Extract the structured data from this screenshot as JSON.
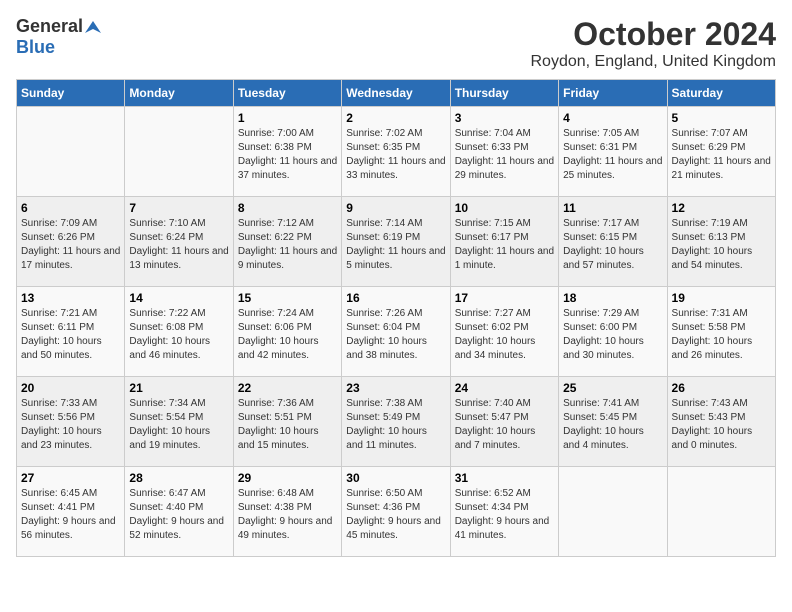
{
  "logo": {
    "general": "General",
    "blue": "Blue"
  },
  "header": {
    "month": "October 2024",
    "location": "Roydon, England, United Kingdom"
  },
  "weekdays": [
    "Sunday",
    "Monday",
    "Tuesday",
    "Wednesday",
    "Thursday",
    "Friday",
    "Saturday"
  ],
  "weeks": [
    [
      {
        "day": "",
        "sunrise": "",
        "sunset": "",
        "daylight": ""
      },
      {
        "day": "",
        "sunrise": "",
        "sunset": "",
        "daylight": ""
      },
      {
        "day": "1",
        "sunrise": "Sunrise: 7:00 AM",
        "sunset": "Sunset: 6:38 PM",
        "daylight": "Daylight: 11 hours and 37 minutes."
      },
      {
        "day": "2",
        "sunrise": "Sunrise: 7:02 AM",
        "sunset": "Sunset: 6:35 PM",
        "daylight": "Daylight: 11 hours and 33 minutes."
      },
      {
        "day": "3",
        "sunrise": "Sunrise: 7:04 AM",
        "sunset": "Sunset: 6:33 PM",
        "daylight": "Daylight: 11 hours and 29 minutes."
      },
      {
        "day": "4",
        "sunrise": "Sunrise: 7:05 AM",
        "sunset": "Sunset: 6:31 PM",
        "daylight": "Daylight: 11 hours and 25 minutes."
      },
      {
        "day": "5",
        "sunrise": "Sunrise: 7:07 AM",
        "sunset": "Sunset: 6:29 PM",
        "daylight": "Daylight: 11 hours and 21 minutes."
      }
    ],
    [
      {
        "day": "6",
        "sunrise": "Sunrise: 7:09 AM",
        "sunset": "Sunset: 6:26 PM",
        "daylight": "Daylight: 11 hours and 17 minutes."
      },
      {
        "day": "7",
        "sunrise": "Sunrise: 7:10 AM",
        "sunset": "Sunset: 6:24 PM",
        "daylight": "Daylight: 11 hours and 13 minutes."
      },
      {
        "day": "8",
        "sunrise": "Sunrise: 7:12 AM",
        "sunset": "Sunset: 6:22 PM",
        "daylight": "Daylight: 11 hours and 9 minutes."
      },
      {
        "day": "9",
        "sunrise": "Sunrise: 7:14 AM",
        "sunset": "Sunset: 6:19 PM",
        "daylight": "Daylight: 11 hours and 5 minutes."
      },
      {
        "day": "10",
        "sunrise": "Sunrise: 7:15 AM",
        "sunset": "Sunset: 6:17 PM",
        "daylight": "Daylight: 11 hours and 1 minute."
      },
      {
        "day": "11",
        "sunrise": "Sunrise: 7:17 AM",
        "sunset": "Sunset: 6:15 PM",
        "daylight": "Daylight: 10 hours and 57 minutes."
      },
      {
        "day": "12",
        "sunrise": "Sunrise: 7:19 AM",
        "sunset": "Sunset: 6:13 PM",
        "daylight": "Daylight: 10 hours and 54 minutes."
      }
    ],
    [
      {
        "day": "13",
        "sunrise": "Sunrise: 7:21 AM",
        "sunset": "Sunset: 6:11 PM",
        "daylight": "Daylight: 10 hours and 50 minutes."
      },
      {
        "day": "14",
        "sunrise": "Sunrise: 7:22 AM",
        "sunset": "Sunset: 6:08 PM",
        "daylight": "Daylight: 10 hours and 46 minutes."
      },
      {
        "day": "15",
        "sunrise": "Sunrise: 7:24 AM",
        "sunset": "Sunset: 6:06 PM",
        "daylight": "Daylight: 10 hours and 42 minutes."
      },
      {
        "day": "16",
        "sunrise": "Sunrise: 7:26 AM",
        "sunset": "Sunset: 6:04 PM",
        "daylight": "Daylight: 10 hours and 38 minutes."
      },
      {
        "day": "17",
        "sunrise": "Sunrise: 7:27 AM",
        "sunset": "Sunset: 6:02 PM",
        "daylight": "Daylight: 10 hours and 34 minutes."
      },
      {
        "day": "18",
        "sunrise": "Sunrise: 7:29 AM",
        "sunset": "Sunset: 6:00 PM",
        "daylight": "Daylight: 10 hours and 30 minutes."
      },
      {
        "day": "19",
        "sunrise": "Sunrise: 7:31 AM",
        "sunset": "Sunset: 5:58 PM",
        "daylight": "Daylight: 10 hours and 26 minutes."
      }
    ],
    [
      {
        "day": "20",
        "sunrise": "Sunrise: 7:33 AM",
        "sunset": "Sunset: 5:56 PM",
        "daylight": "Daylight: 10 hours and 23 minutes."
      },
      {
        "day": "21",
        "sunrise": "Sunrise: 7:34 AM",
        "sunset": "Sunset: 5:54 PM",
        "daylight": "Daylight: 10 hours and 19 minutes."
      },
      {
        "day": "22",
        "sunrise": "Sunrise: 7:36 AM",
        "sunset": "Sunset: 5:51 PM",
        "daylight": "Daylight: 10 hours and 15 minutes."
      },
      {
        "day": "23",
        "sunrise": "Sunrise: 7:38 AM",
        "sunset": "Sunset: 5:49 PM",
        "daylight": "Daylight: 10 hours and 11 minutes."
      },
      {
        "day": "24",
        "sunrise": "Sunrise: 7:40 AM",
        "sunset": "Sunset: 5:47 PM",
        "daylight": "Daylight: 10 hours and 7 minutes."
      },
      {
        "day": "25",
        "sunrise": "Sunrise: 7:41 AM",
        "sunset": "Sunset: 5:45 PM",
        "daylight": "Daylight: 10 hours and 4 minutes."
      },
      {
        "day": "26",
        "sunrise": "Sunrise: 7:43 AM",
        "sunset": "Sunset: 5:43 PM",
        "daylight": "Daylight: 10 hours and 0 minutes."
      }
    ],
    [
      {
        "day": "27",
        "sunrise": "Sunrise: 6:45 AM",
        "sunset": "Sunset: 4:41 PM",
        "daylight": "Daylight: 9 hours and 56 minutes."
      },
      {
        "day": "28",
        "sunrise": "Sunrise: 6:47 AM",
        "sunset": "Sunset: 4:40 PM",
        "daylight": "Daylight: 9 hours and 52 minutes."
      },
      {
        "day": "29",
        "sunrise": "Sunrise: 6:48 AM",
        "sunset": "Sunset: 4:38 PM",
        "daylight": "Daylight: 9 hours and 49 minutes."
      },
      {
        "day": "30",
        "sunrise": "Sunrise: 6:50 AM",
        "sunset": "Sunset: 4:36 PM",
        "daylight": "Daylight: 9 hours and 45 minutes."
      },
      {
        "day": "31",
        "sunrise": "Sunrise: 6:52 AM",
        "sunset": "Sunset: 4:34 PM",
        "daylight": "Daylight: 9 hours and 41 minutes."
      },
      {
        "day": "",
        "sunrise": "",
        "sunset": "",
        "daylight": ""
      },
      {
        "day": "",
        "sunrise": "",
        "sunset": "",
        "daylight": ""
      }
    ]
  ]
}
